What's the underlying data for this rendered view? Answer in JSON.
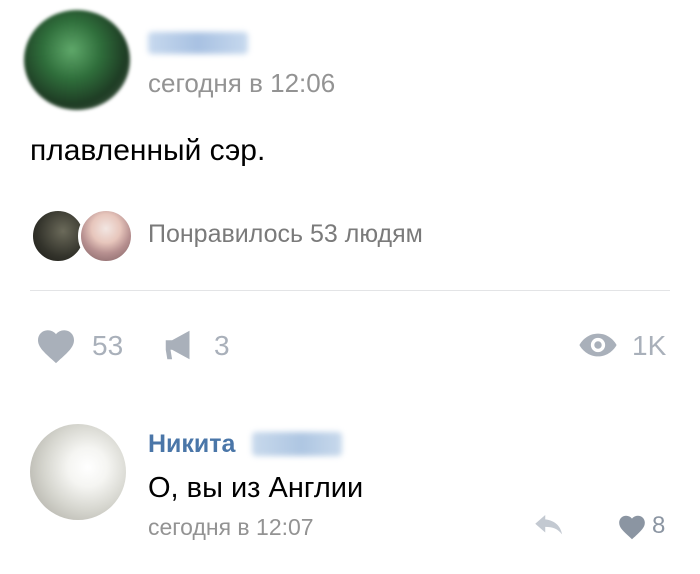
{
  "post": {
    "time": "сегодня в 12:06",
    "text": "плавленный сэр.",
    "likes_text": "Понравилось 53 людям"
  },
  "actions": {
    "likes": "53",
    "shares": "3",
    "views": "1K"
  },
  "comment": {
    "author_first_name": "Никита",
    "text": "О, вы из Англии",
    "time": "сегодня в 12:07",
    "likes": "8"
  },
  "icons": {
    "like": "heart-icon",
    "share": "megaphone-icon",
    "views": "eye-icon",
    "reply": "reply-arrow-icon"
  },
  "colors": {
    "link": "#4a76a8",
    "muted": "#939393",
    "icon": "#a9b0ba",
    "divider": "#e3e4e6"
  }
}
